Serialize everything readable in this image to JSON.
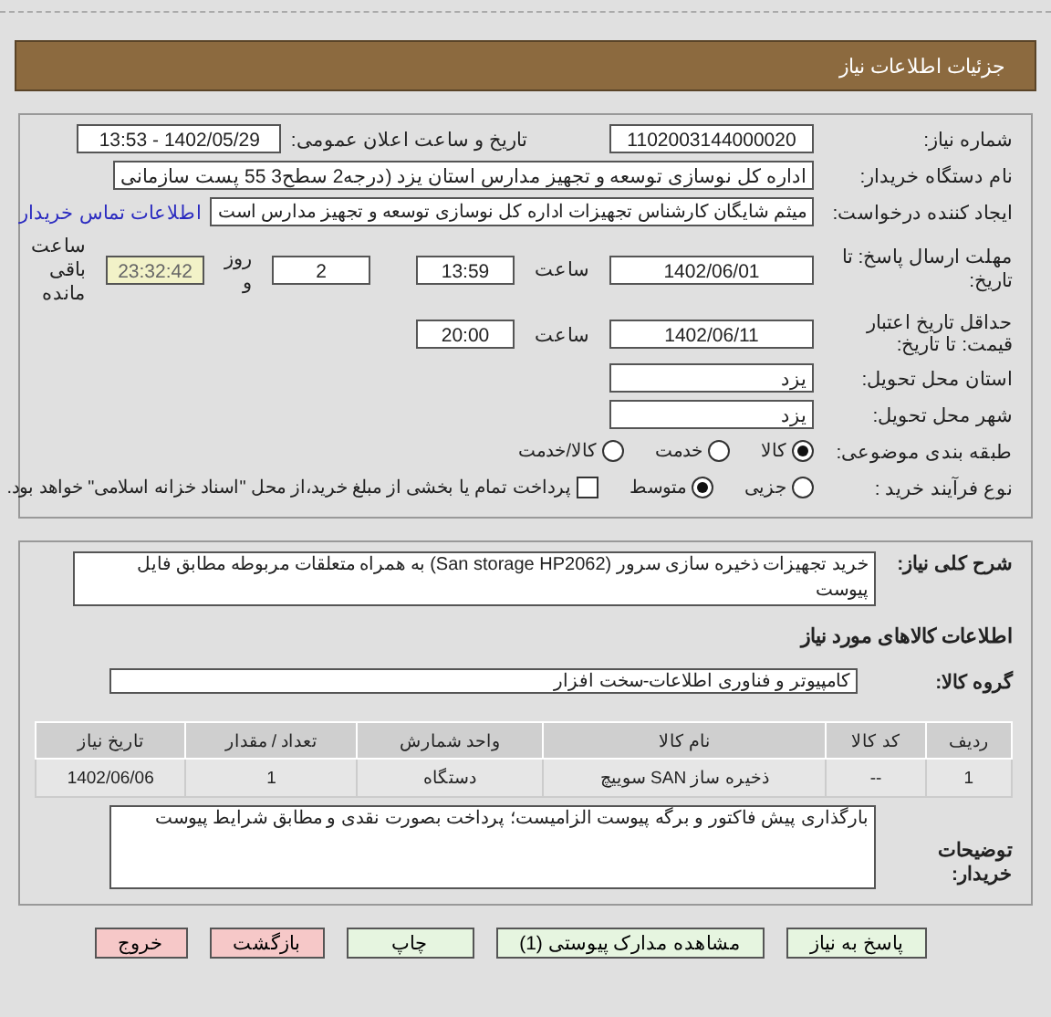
{
  "header": {
    "title": "جزئیات اطلاعات نیاز"
  },
  "need_number": {
    "label": "شماره نیاز:",
    "value": "1102003144000020"
  },
  "announce": {
    "label": "تاریخ و ساعت اعلان عمومی:",
    "value": "1402/05/29 - 13:53"
  },
  "buyer": {
    "label": "نام دستگاه خریدار:",
    "value": "اداره کل نوسازی   توسعه و تجهیز مدارس استان یزد (درجه2  سطح3  55 پست سازمانی"
  },
  "creator": {
    "label": "ایجاد کننده درخواست:",
    "value": "میثم شایگان کارشناس تجهیزات اداره کل نوسازی   توسعه و تجهیز مدارس است",
    "link": "اطلاعات تماس خریدار"
  },
  "deadline": {
    "label": "مهلت ارسال پاسخ: تا تاریخ:",
    "date": "1402/06/01",
    "time_label": "ساعت",
    "time": "13:59",
    "days": "2",
    "days_label": "روز و",
    "remaining": "23:32:42",
    "remaining_label": "ساعت باقی مانده"
  },
  "validity": {
    "label": "حداقل تاریخ اعتبار قیمت: تا تاریخ:",
    "date": "1402/06/11",
    "time_label": "ساعت",
    "time": "20:00"
  },
  "province": {
    "label": "استان محل تحویل:",
    "value": "یزد"
  },
  "city": {
    "label": "شهر محل تحویل:",
    "value": "یزد"
  },
  "category": {
    "label": "طبقه بندی موضوعی:",
    "options": [
      {
        "label": "کالا",
        "selected": true
      },
      {
        "label": "خدمت",
        "selected": false
      },
      {
        "label": "کالا/خدمت",
        "selected": false
      }
    ]
  },
  "process": {
    "label": "نوع فرآیند خرید :",
    "options": [
      {
        "label": "جزیی",
        "selected": false
      },
      {
        "label": "متوسط",
        "selected": true
      }
    ],
    "treasury": {
      "label": "پرداخت تمام یا بخشی از مبلغ خرید،از محل \"اسناد خزانه اسلامی\" خواهد بود.",
      "checked": false
    }
  },
  "description": {
    "label": "شرح کلی نیاز:",
    "value": "خرید تجهیزات ذخیره سازی سرور (San storage HP2062) به همراه متعلقات مربوطه مطابق فایل پیوست"
  },
  "goods_heading": "اطلاعات کالاهای مورد نیاز",
  "goods_group": {
    "label": "گروه کالا:",
    "value": "کامپیوتر و فناوری اطلاعات-سخت افزار"
  },
  "table": {
    "columns": [
      "ردیف",
      "کد کالا",
      "نام کالا",
      "واحد شمارش",
      "تعداد / مقدار",
      "تاریخ نیاز"
    ],
    "rows": [
      [
        "1",
        "--",
        "ذخیره ساز SAN سوییچ",
        "دستگاه",
        "1",
        "1402/06/06"
      ]
    ]
  },
  "buyer_notes": {
    "label": "توضیحات خریدار:",
    "value": "بارگذاری پیش فاکتور و برگه پیوست الزامیست؛ پرداخت بصورت نقدی و مطابق شرایط پیوست"
  },
  "buttons": [
    {
      "label": "پاسخ به نیاز",
      "kind": "normal"
    },
    {
      "label": "مشاهده مدارک پیوستی (1)",
      "kind": "normal"
    },
    {
      "label": "چاپ",
      "kind": "normal"
    },
    {
      "label": "بازگشت",
      "kind": "alert"
    },
    {
      "label": "خروج",
      "kind": "alert"
    }
  ]
}
